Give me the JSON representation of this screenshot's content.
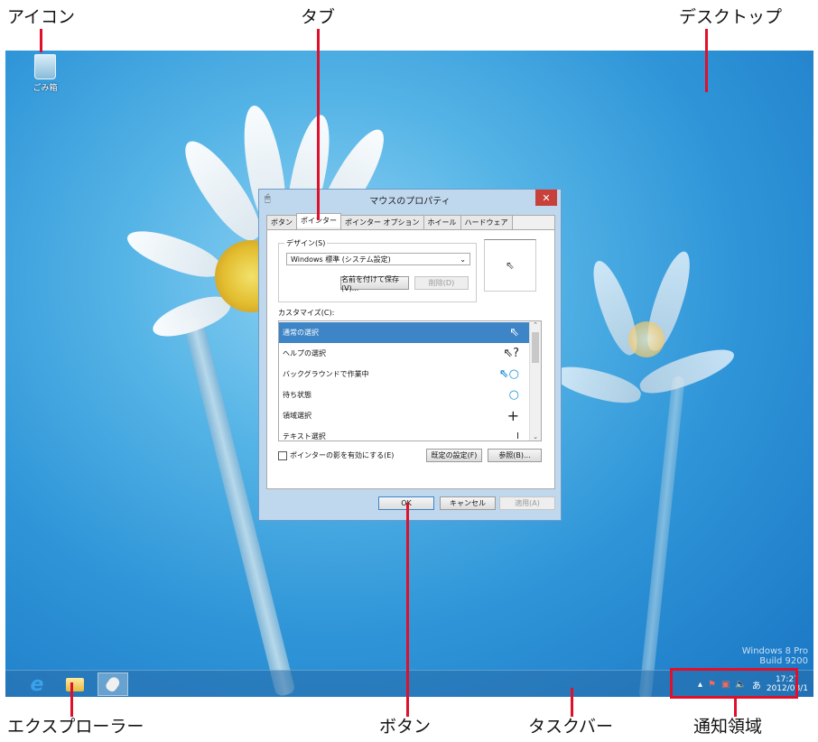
{
  "callouts": {
    "icon": "アイコン",
    "tab": "タブ",
    "desktop": "デスクトップ",
    "explorer": "エクスプローラー",
    "button": "ボタン",
    "taskbar": "タスクバー",
    "notification_area": "通知領域"
  },
  "desktop": {
    "recycle_bin_label": "ごみ箱",
    "watermark_line1": "Windows 8 Pro",
    "watermark_line2": "Build 9200"
  },
  "dialog": {
    "title": "マウスのプロパティ",
    "close_glyph": "✕",
    "tabs": [
      "ボタン",
      "ポインター",
      "ポインター オプション",
      "ホイール",
      "ハードウェア"
    ],
    "active_tab": 1,
    "design_label": "デザイン(S)",
    "scheme_value": "Windows 標準 (システム設定)",
    "save_as_label": "名前を付けて保存(V)...",
    "delete_label": "削除(D)",
    "customize_label": "カスタマイズ(C):",
    "list_items": [
      {
        "label": "通常の選択",
        "cursor": "⇖"
      },
      {
        "label": "ヘルプの選択",
        "cursor": "⇖?"
      },
      {
        "label": "バックグラウンドで作業中",
        "cursor": "⇖○"
      },
      {
        "label": "待ち状態",
        "cursor": "○"
      },
      {
        "label": "領域選択",
        "cursor": "+"
      },
      {
        "label": "テキスト選択",
        "cursor": "I"
      }
    ],
    "selected_index": 0,
    "shadow_checkbox_label": "ポインターの影を有効にする(E)",
    "default_label": "既定の設定(F)",
    "browse_label": "参照(B)...",
    "ok_label": "OK",
    "cancel_label": "キャンセル",
    "apply_label": "適用(A)"
  },
  "tray": {
    "language": "あ",
    "time": "17:27",
    "date": "2012/08/1"
  },
  "colors": {
    "accent_red": "#e0102a",
    "selection_blue": "#3d85c6",
    "desktop_blue": "#2f95d8"
  }
}
